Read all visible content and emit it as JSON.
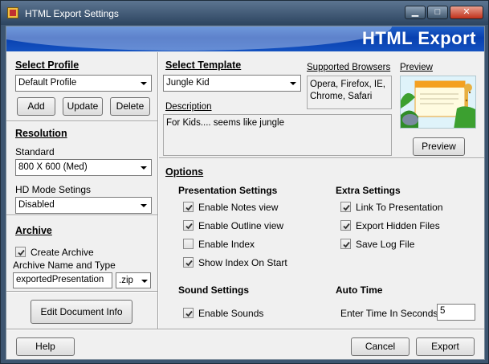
{
  "window": {
    "title": "HTML Export Settings",
    "banner": "HTML Export"
  },
  "titlebar_buttons": {
    "minimize": "▁",
    "maximize": "□",
    "close": "✕"
  },
  "profile": {
    "heading": "Select Profile",
    "selected": "Default Profile",
    "add_label": "Add",
    "update_label": "Update",
    "delete_label": "Delete"
  },
  "resolution": {
    "heading": "Resolution",
    "standard_label": "Standard",
    "standard_value": "800 X 600 (Med)",
    "hd_label": "HD Mode Setings",
    "hd_value": "Disabled"
  },
  "archive": {
    "heading": "Archive",
    "create_label": "Create Archive",
    "create_checked": true,
    "name_type_label": "Archive Name and Type",
    "name_value": "exportedPresentation",
    "type_value": ".zip"
  },
  "edit_doc_label": "Edit Document Info",
  "template": {
    "heading": "Select Template",
    "selected": "Jungle Kid",
    "browsers_label": "Supported Browsers",
    "browsers_value": "Opera, Firefox, IE, Chrome, Safari",
    "description_label": "Description",
    "description_value": "For Kids.... seems like jungle",
    "preview_label": "Preview",
    "preview_button": "Preview"
  },
  "options": {
    "heading": "Options",
    "presentation": {
      "heading": "Presentation Settings",
      "items": [
        {
          "label": "Enable Notes view",
          "checked": true
        },
        {
          "label": "Enable Outline view",
          "checked": true
        },
        {
          "label": "Enable Index",
          "checked": false
        },
        {
          "label": "Show Index On Start",
          "checked": true
        }
      ]
    },
    "extra": {
      "heading": "Extra Settings",
      "items": [
        {
          "label": "Link To Presentation",
          "checked": true
        },
        {
          "label": "Export Hidden Files",
          "checked": true
        },
        {
          "label": "Save Log File",
          "checked": true
        }
      ]
    },
    "sound": {
      "heading": "Sound Settings",
      "enable_label": "Enable Sounds",
      "enable_checked": true
    },
    "auto_time": {
      "heading": "Auto Time",
      "label": "Enter Time In Seconds:",
      "value": "5"
    }
  },
  "footer": {
    "help_label": "Help",
    "cancel_label": "Cancel",
    "export_label": "Export"
  }
}
